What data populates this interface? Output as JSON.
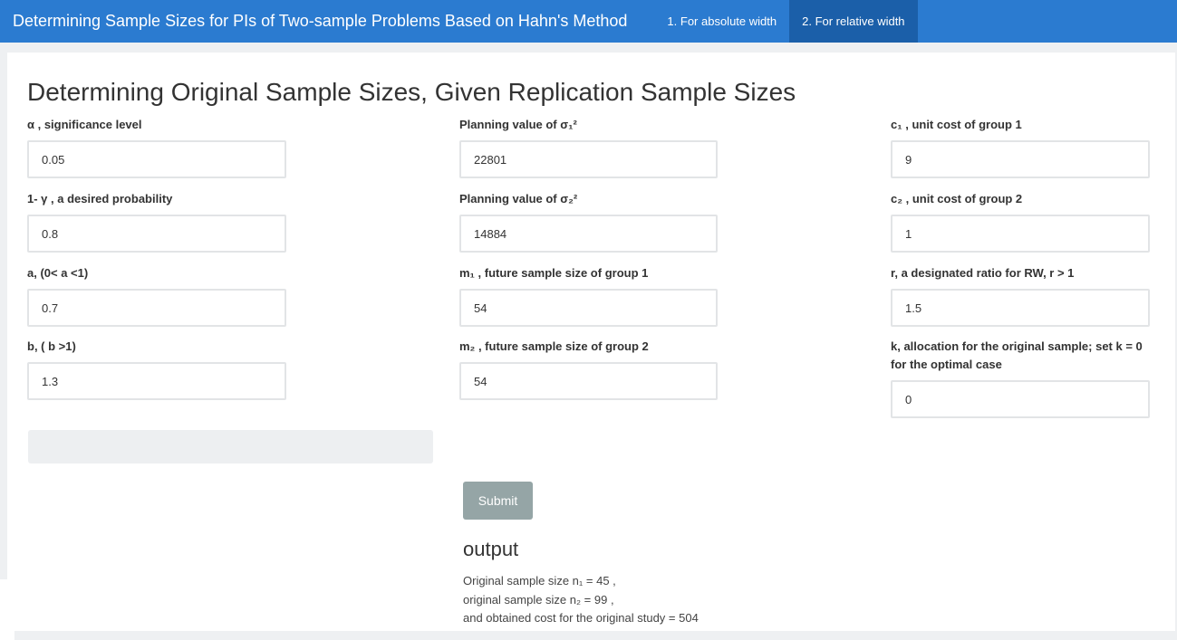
{
  "navbar": {
    "brand": "Determining Sample Sizes for PIs of Two-sample Problems Based on Hahn's Method",
    "tabs": [
      {
        "label": "1. For absolute width",
        "active": false
      },
      {
        "label": "2. For relative width",
        "active": true
      }
    ]
  },
  "page_title": "Determining Original Sample Sizes, Given Replication Sample Sizes",
  "fields": {
    "alpha": {
      "label": "α , significance level",
      "value": "0.05"
    },
    "gamma": {
      "label": "1- γ , a desired probability",
      "value": "0.8"
    },
    "a": {
      "label": "a, (0< a <1)",
      "value": "0.7"
    },
    "b": {
      "label": "b, ( b >1)",
      "value": "1.3"
    },
    "sigma1": {
      "label": "Planning value of σ₁²",
      "value": "22801"
    },
    "sigma2": {
      "label": "Planning value of σ₂²",
      "value": "14884"
    },
    "m1": {
      "label": "m₁ , future sample size of group 1",
      "value": "54"
    },
    "m2": {
      "label": "m₂ , future sample size of group 2",
      "value": "54"
    },
    "c1": {
      "label": "c₁ , unit cost of group 1",
      "value": "9"
    },
    "c2": {
      "label": "c₂ , unit cost of group 2",
      "value": "1"
    },
    "r": {
      "label": "r, a designated ratio for RW, r > 1",
      "value": "1.5"
    },
    "k": {
      "label": "k, allocation for the original sample; set k = 0 for the optimal case",
      "value": "0"
    }
  },
  "submit_label": "Submit",
  "output": {
    "title": "output",
    "lines": [
      "Original sample size n₁ = 45 ,",
      "original sample size n₂ = 99 ,",
      "and obtained cost for the original study = 504"
    ]
  },
  "colors": {
    "navbar": "#2b7bd0",
    "navbar_active_tab": "#1b5fa9",
    "submit_button": "#95a5a6",
    "background": "#eef0f2"
  }
}
